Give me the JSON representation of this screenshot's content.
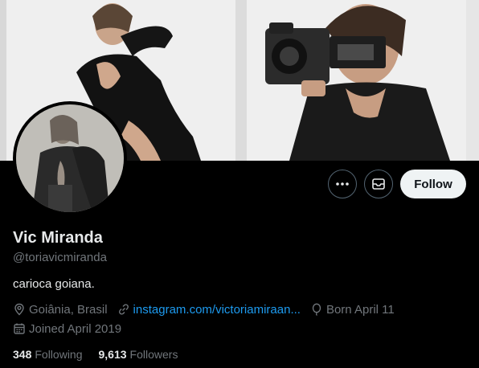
{
  "profile": {
    "name": "Vic Miranda",
    "handle": "@toriavicmiranda",
    "bio": "carioca goiana.",
    "location": "Goiânia, Brasil",
    "website": "instagram.com/victoriamiraan...",
    "birthday": "Born April 11",
    "joined": "Joined April 2019"
  },
  "actions": {
    "more_icon": "more-icon",
    "message_icon": "mail-icon",
    "follow_label": "Follow"
  },
  "stats": {
    "following_count": "348",
    "following_label": "Following",
    "followers_count": "9,613",
    "followers_label": "Followers"
  },
  "colors": {
    "background": "#000000",
    "primary_text": "#e7e9ea",
    "secondary_text": "#71767b",
    "link": "#1d9bf0",
    "follow_button_bg": "#eff3f4"
  }
}
